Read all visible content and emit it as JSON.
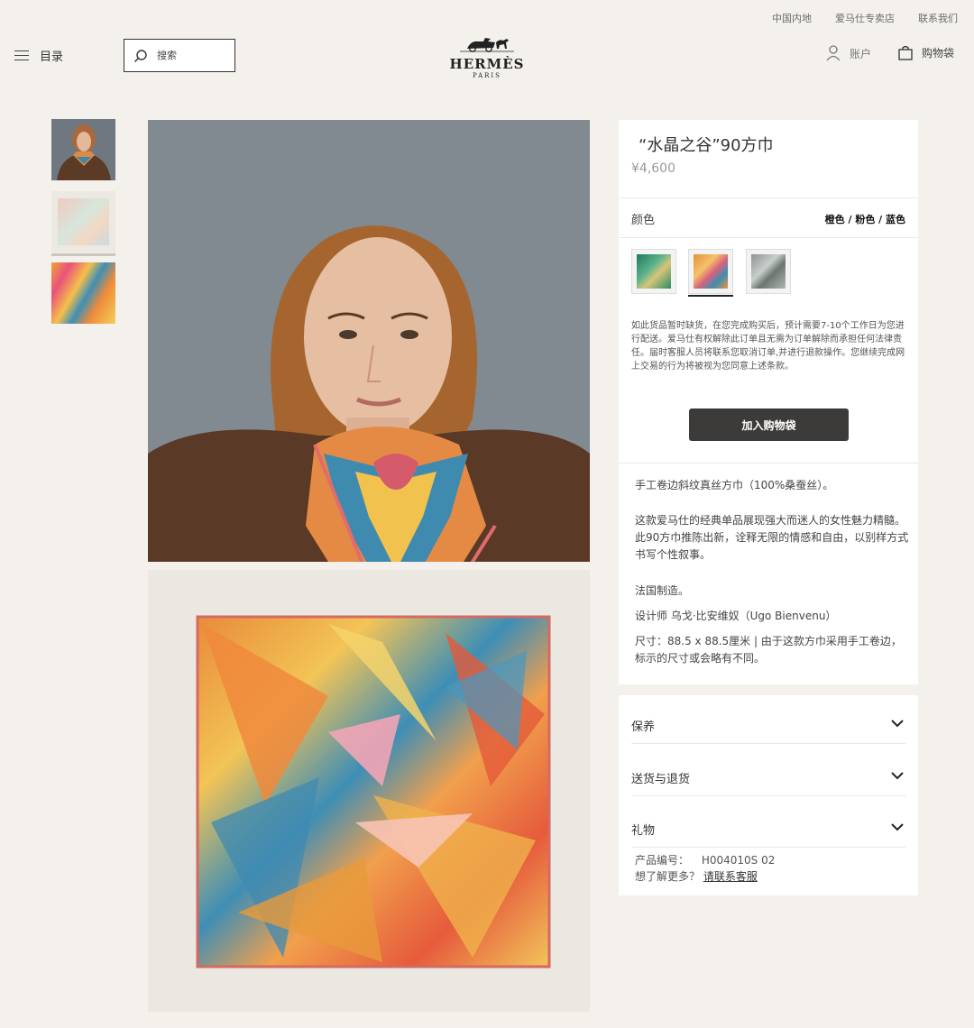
{
  "utility_links": [
    "中国内地",
    "爱马仕专卖店",
    "联系我们"
  ],
  "header": {
    "menu_label": "目录",
    "search_placeholder": "搜索",
    "brand": "HERMÈS",
    "city": "PARIS",
    "account_label": "账户",
    "cart_label": "购物袋"
  },
  "product": {
    "title": "“水晶之谷”90方巾",
    "price": "¥4,600",
    "color_label": "颜色",
    "color_value": "橙色 / 粉色 / 蓝色",
    "swatches": [
      "green-variant",
      "orange-pink-blue-variant",
      "grey-variant"
    ],
    "notice": "如此货品暂时缺货，在您完成购买后，预计需要7-10个工作日为您进行配送。爱马仕有权解除此订单且无需为订单解除而承担任何法律责任。届时客服人员将联系您取消订单,并进行退款操作。您继续完成网上交易的行为将被视为您同意上述条款。",
    "add_to_bag": "加入购物袋",
    "desc_1": "手工卷边斜纹真丝方巾（100%桑蚕丝）。",
    "desc_2": "这款爱马仕的经典单品展现强大而迷人的女性魅力精髓。此90方巾推陈出新，诠释无限的情感和自由，以别样方式书写个性叙事。",
    "desc_3": "法国制造。",
    "desc_4": "设计师 乌戈·比安维奴（Ugo Bienvenu）",
    "desc_5": "尺寸：88.5 x 88.5厘米 | 由于这款方巾采用手工卷边，标示的尺寸或会略有不同。"
  },
  "accordion": {
    "care": "保养",
    "shipping": "送货与退货",
    "gift": "礼物"
  },
  "meta": {
    "sku_label": "产品编号：",
    "sku_value": "H004010S 02",
    "help_text": "想了解更多？",
    "help_link": "请联系客服"
  },
  "colors": {
    "background": "#f4f1ec",
    "button": "#3d3b39",
    "panel": "#ffffff"
  }
}
